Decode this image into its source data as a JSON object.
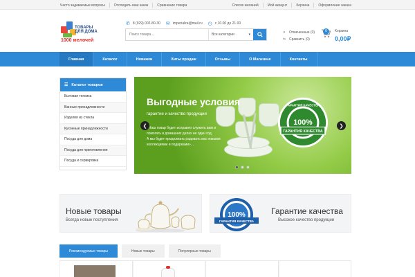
{
  "topbar": {
    "left_links": [
      "Часто задаваемые вопросы",
      "Отследить ваш заказ",
      "Сравнение товара"
    ],
    "right_links": [
      "Список желаний",
      "Мой аккаунт",
      "Корзина",
      "Оформление заказа"
    ]
  },
  "logo": {
    "line1": "ТОВАРЫ ДЛЯ ДОМА",
    "line2": "1000 мелочей"
  },
  "contacts": {
    "phone": "8 (929) 002-80-30",
    "email": "imperialza@mail.ru",
    "hours": "с 10.00 до 21.00"
  },
  "search": {
    "placeholder": "Поиск товара...",
    "category": "Все категории"
  },
  "header_links": {
    "wishlist": "Отмеченные (0)",
    "compare": "Сравнить (0)"
  },
  "cart": {
    "count": "0",
    "label": "Корзина",
    "total": "0,00₽"
  },
  "nav": [
    "Главная",
    "Каталог",
    "Новинки",
    "Хиты продаж",
    "Отзывы",
    "О Магазине",
    "Контакты"
  ],
  "catalog": {
    "title": "Каталог товаров",
    "items": [
      "Бытовая техника",
      "Ванные принадлежности",
      "Изделия из стекла",
      "Кухонные принадлежности",
      "Посуда для дома",
      "Посуда для приготовления",
      "Посуда и сервировка"
    ]
  },
  "slider": {
    "title": "Выгодные условия",
    "subtitle": "гарантие и качество продукции",
    "desc_lines": [
      "«Наш товар будет исправно служить вам и",
      "помогать в домашних делах не один год.",
      "А мы будет продолжать радовать вас новыми",
      "коллекциями и подарками»..."
    ],
    "seal_top": "ГАРАНТИЯ КАЧЕСТВА",
    "seal_percent": "100%",
    "seal_bottom": "ГАРАНТИЯ КАЧЕСТВА",
    "dots": 3,
    "active_dot": 0
  },
  "banners": {
    "new": {
      "title": "Новые товары",
      "subtitle": "Всегда новые поступления"
    },
    "quality": {
      "title": "Гарантие качества",
      "subtitle": "Высокое качество продукции",
      "seal_percent": "100%",
      "seal_text": "ГАРАНТИЯ КАЧЕСТВА"
    }
  },
  "tabs": [
    "Рекомендуемые товары",
    "Новые товары",
    "Популярные товары"
  ],
  "colors": {
    "accent": "#2e8ad6",
    "slider_green": "#79bd31"
  }
}
